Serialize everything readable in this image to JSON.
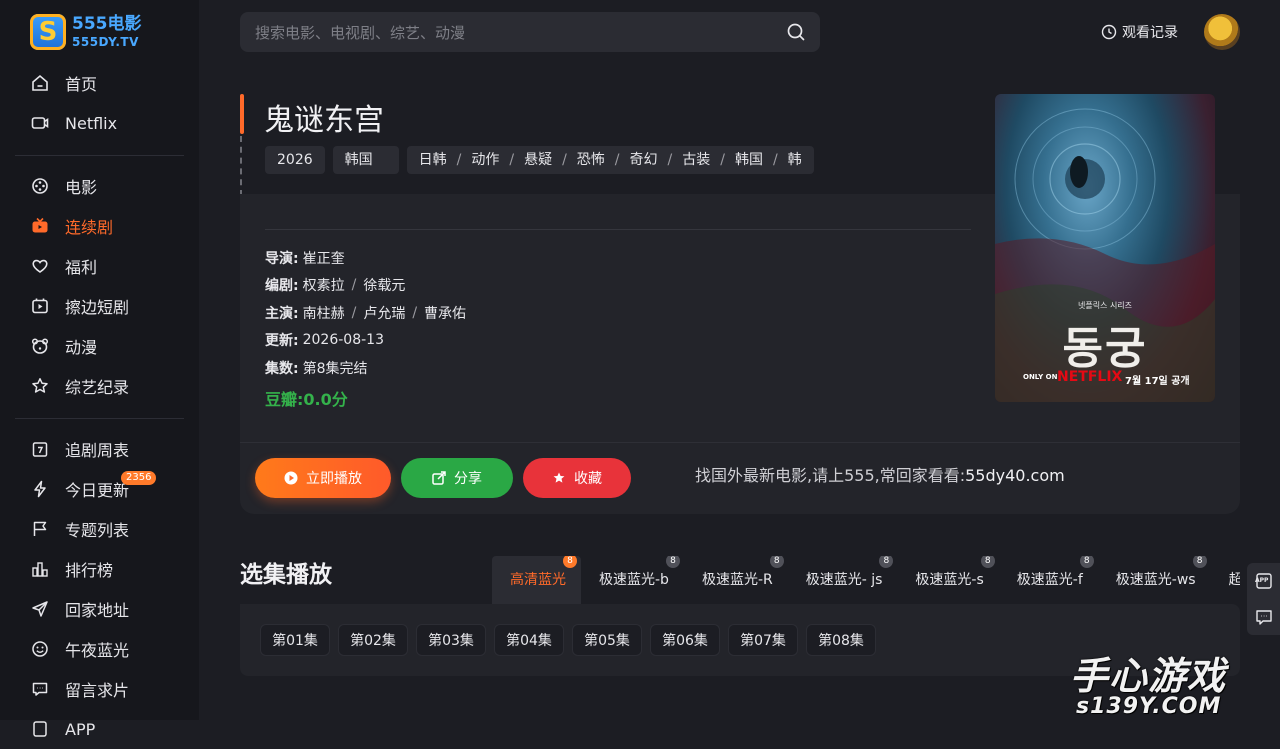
{
  "logo": {
    "line1": "555电影",
    "line2": "555DY.TV",
    "badge": "S"
  },
  "search": {
    "placeholder": "搜索电影、电视剧、综艺、动漫"
  },
  "header": {
    "history_label": "观看记录"
  },
  "sidebar": {
    "group1": [
      {
        "label": "首页",
        "icon": "home-icon"
      },
      {
        "label": "Netflix",
        "icon": "tv-icon"
      }
    ],
    "group2": [
      {
        "label": "电影",
        "icon": "film-reel-icon"
      },
      {
        "label": "连续剧",
        "icon": "tv-series-icon",
        "active": true
      },
      {
        "label": "福利",
        "icon": "heart-icon"
      },
      {
        "label": "擦边短剧",
        "icon": "play-box-icon"
      },
      {
        "label": "动漫",
        "icon": "bear-icon"
      },
      {
        "label": "综艺纪录",
        "icon": "star-icon"
      }
    ],
    "group3": [
      {
        "label": "追剧周表",
        "icon": "calendar-icon"
      },
      {
        "label": "今日更新",
        "icon": "lightning-icon",
        "badge": "2356"
      },
      {
        "label": "专题列表",
        "icon": "flag-icon"
      },
      {
        "label": "排行榜",
        "icon": "bar-chart-icon"
      },
      {
        "label": "回家地址",
        "icon": "paper-plane-icon"
      },
      {
        "label": "午夜蓝光",
        "icon": "smile-icon"
      },
      {
        "label": "留言求片",
        "icon": "message-icon"
      },
      {
        "label": "APP",
        "icon": "app-icon"
      }
    ]
  },
  "detail": {
    "title": "鬼谜东宫",
    "year": "2026",
    "region": "韩国",
    "genres": [
      "日韩",
      "动作",
      "悬疑",
      "恐怖",
      "奇幻",
      "古装",
      "韩国",
      "韩"
    ],
    "director_label": "导演:",
    "director": "崔正奎",
    "writer_label": "编剧:",
    "writers": [
      "权素拉",
      "徐载元"
    ],
    "cast_label": "主演:",
    "cast": [
      "南柱赫",
      "卢允瑞",
      "曹承佑"
    ],
    "updated_label": "更新:",
    "updated": "2026-08-13",
    "episodes_label": "集数:",
    "episodes_value": "第8集完结",
    "douban": "豆瓣:0.0分"
  },
  "actions": {
    "play": "立即播放",
    "share": "分享",
    "favorite": "收藏"
  },
  "promo": {
    "text": "找国外最新电影,请上555,常回家看看:",
    "domain": "55dy40.com"
  },
  "poster": {
    "small_text": "넷플릭스 시리즈",
    "main_text": "동궁",
    "only_on": "ONLY ON",
    "brand": "NETFLIX",
    "date": "7월 17일 공개"
  },
  "episodes_section": {
    "title": "选集播放",
    "sources": [
      {
        "label": "高清蓝光",
        "count": "8",
        "active": true
      },
      {
        "label": "极速蓝光-b",
        "count": "8"
      },
      {
        "label": "极速蓝光-R",
        "count": "8"
      },
      {
        "label": "极速蓝光- js",
        "count": "8"
      },
      {
        "label": "极速蓝光-s",
        "count": "8"
      },
      {
        "label": "极速蓝光-f",
        "count": "8"
      },
      {
        "label": "极速蓝光-ws",
        "count": "8"
      },
      {
        "label": "超清",
        "count": ""
      }
    ],
    "list": [
      "第01集",
      "第02集",
      "第03集",
      "第04集",
      "第05集",
      "第06集",
      "第07集",
      "第08集"
    ]
  },
  "float_tools": {
    "app_label": "APP"
  },
  "watermark": {
    "main": "手心游戏",
    "sub": "s139Y.COM"
  },
  "accent_color": "#ff6a2a"
}
